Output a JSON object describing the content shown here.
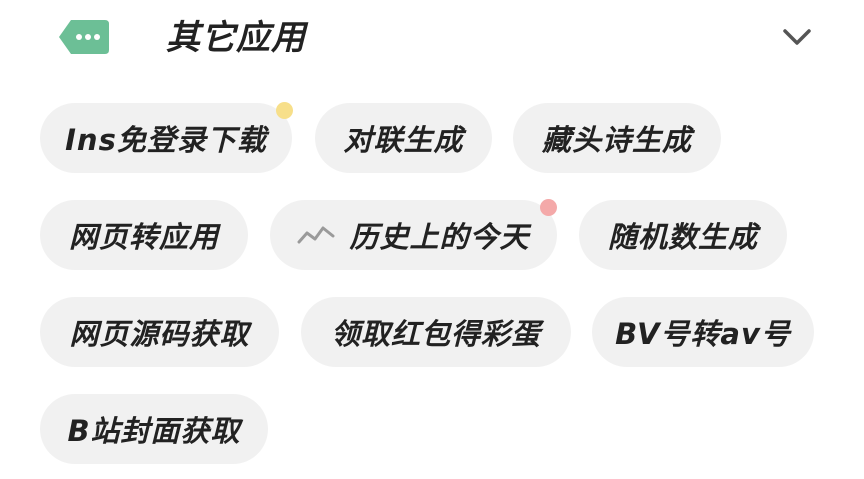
{
  "section": {
    "title": "其它应用",
    "icon": "tag-dots-icon",
    "expand_icon": "chevron-down-icon",
    "accent_color": "#6cbf96"
  },
  "apps": [
    {
      "label": "Ins免登录下载",
      "badge_color": "#f7df8a"
    },
    {
      "label": "对联生成"
    },
    {
      "label": "藏头诗生成"
    },
    {
      "label": "网页转应用"
    },
    {
      "label": "历史上的今天",
      "icon": "trend-line-icon",
      "badge_color": "#f4a9a9"
    },
    {
      "label": "随机数生成"
    },
    {
      "label": "网页源码获取"
    },
    {
      "label": "领取红包得彩蛋"
    },
    {
      "label": "BV号转av号"
    },
    {
      "label": "B站封面获取"
    }
  ]
}
